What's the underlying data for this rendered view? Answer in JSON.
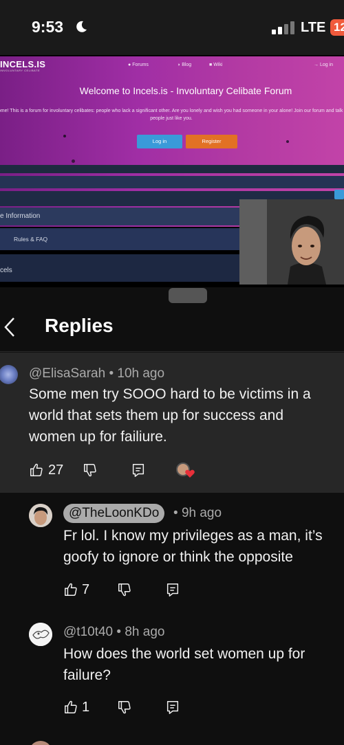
{
  "status_bar": {
    "time": "9:53",
    "network": "LTE",
    "battery": "12"
  },
  "video": {
    "forum": {
      "logo": "INCELS.IS",
      "logo_sub": "INVOLUNTARY CELIBATE",
      "nav": {
        "forums": "Forums",
        "blog": "Blog",
        "wiki": "Wiki",
        "login": "Log in"
      },
      "title": "Welcome to Incels.is - Involuntary Celibate Forum",
      "description": "icome! This is a forum for involuntary celibates: people who lack a significant other. Are you lonely and wish you had someone in your alone! Join our forum and talk to people just like you.",
      "login_button": "Log in",
      "register_button": "Register",
      "section_info": "e Information",
      "section_rules": "Rules & FAQ",
      "section_incels": "cels"
    }
  },
  "header": {
    "title": "Replies"
  },
  "parent_comment": {
    "handle": "@ElisaSarah",
    "time": "10h ago",
    "text_lines": [
      "Some men try SOOO hard to be victims in a",
      "world that sets them up for success and",
      "women up for failiure."
    ],
    "likes": "27"
  },
  "replies": [
    {
      "handle": "@TheLoonKDo",
      "time": "9h ago",
      "text_lines": [
        "Fr lol. I know my privileges as a man, it’s",
        "goofy to ignore or think the opposite"
      ],
      "likes": "7"
    },
    {
      "handle": "@t10t40",
      "time": "8h ago",
      "text_lines": [
        "How does the world set women up for",
        "failure?"
      ],
      "likes": "1"
    }
  ],
  "colors": {
    "background": "#0f0f0f",
    "parent_bg": "#272727",
    "forum_purple": "#a02ea5",
    "heart": "#e8303a"
  },
  "icons": [
    "moon-icon",
    "signal-icon",
    "back-icon",
    "thumbs-up-icon",
    "thumbs-down-icon",
    "reply-icon",
    "heart-icon"
  ]
}
